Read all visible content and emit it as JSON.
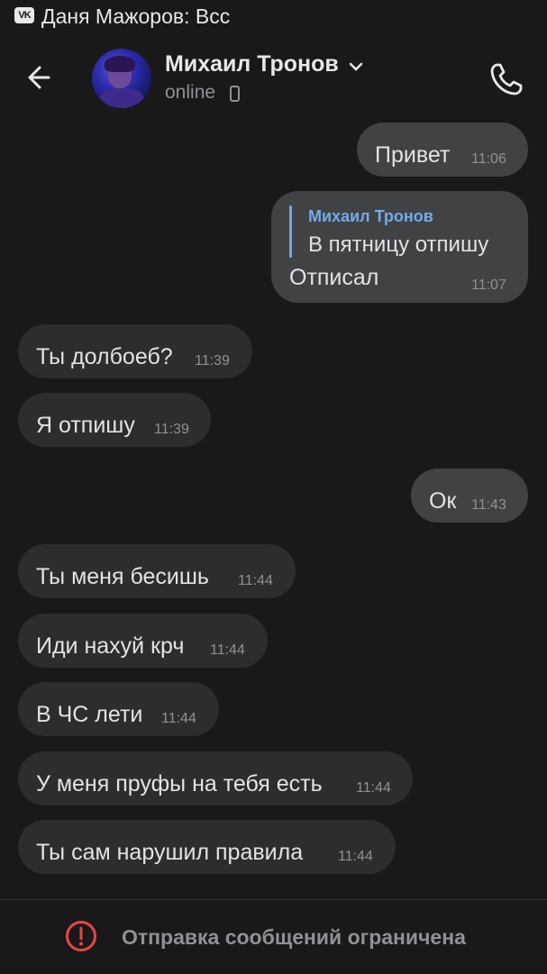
{
  "status_bar": {
    "notification_text": "Даня Мажоров: Всс",
    "app_icon": "vk-icon",
    "app_logo_text": "VK"
  },
  "header": {
    "contact_name": "Михаил Тронов",
    "contact_status": "online",
    "icons": [
      "back-arrow-icon",
      "chevron-down-icon",
      "mobile-phone-icon",
      "phone-call-icon"
    ]
  },
  "messages": [
    {
      "direction": "outgoing",
      "text": "Привет",
      "time": "11:06"
    },
    {
      "direction": "outgoing",
      "reply_to_author": "Михаил Тронов",
      "reply_to_text": "В пятницу отпишу",
      "text": "Отписал",
      "time": "11:07"
    },
    {
      "direction": "incoming",
      "text": "Ты долбоеб?",
      "time": "11:39"
    },
    {
      "direction": "incoming",
      "text": "Я отпишу",
      "time": "11:39"
    },
    {
      "direction": "outgoing",
      "text": "Ок",
      "time": "11:43"
    },
    {
      "direction": "incoming",
      "text": "Ты меня бесишь",
      "time": "11:44"
    },
    {
      "direction": "incoming",
      "text": "Иди нахуй крч",
      "time": "11:44"
    },
    {
      "direction": "incoming",
      "text": "В ЧС лети",
      "time": "11:44"
    },
    {
      "direction": "incoming",
      "text": "У меня пруфы на тебя есть",
      "time": "11:44"
    },
    {
      "direction": "incoming",
      "text": "Ты сам нарушил правила",
      "time": "11:44"
    }
  ],
  "footer": {
    "restriction_text": "Отправка сообщений ограничена",
    "icon": "warning-circle-icon"
  },
  "colors": {
    "background": "#19191a",
    "incoming_bubble": "#2c2d2e",
    "outgoing_bubble": "#414243",
    "accent": "#71aaeb",
    "warning": "#e64646"
  }
}
